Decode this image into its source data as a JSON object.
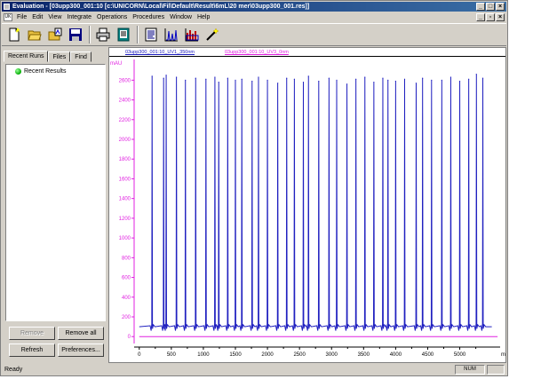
{
  "window": {
    "title": "Evaluation - [03upp300_001:10  [c:\\UNICORN\\Local\\Fil\\Default\\Result\\6mL\\20 mer\\03upp300_001.res]]"
  },
  "menu": {
    "items": [
      "File",
      "Edit",
      "View",
      "Integrate",
      "Operations",
      "Procedures",
      "Window",
      "Help"
    ]
  },
  "toolbar": {
    "buttons": [
      "new-icon",
      "open-folder-icon",
      "open-result-icon",
      "save-icon",
      "print-icon",
      "method-icon",
      "report-icon",
      "chromatogram-icon",
      "peak-table-icon",
      "wand-icon"
    ]
  },
  "left_panel": {
    "tabs": [
      "Recent Runs",
      "Files",
      "Find"
    ],
    "active_tab": "Recent Runs",
    "tree_item": "Recent Results",
    "buttons": {
      "remove": "Remove",
      "remove_all": "Remove all",
      "refresh": "Refresh",
      "preferences": "Preferences..."
    }
  },
  "chart_data": {
    "type": "line",
    "legend": [
      {
        "name": "03upp300_001:10_UV1_350nm",
        "color": "#2020c0"
      },
      {
        "name": "03upp300_001:10_UV3_0nm",
        "color": "#e020e0"
      }
    ],
    "ylabel": "mAU",
    "xlabel": "ml",
    "xlim": [
      -80,
      5630
    ],
    "ylim": [
      -70,
      2720
    ],
    "xticks": [
      0,
      500,
      1000,
      1500,
      2000,
      2500,
      3000,
      3500,
      4000,
      4500,
      5000
    ],
    "yticks": [
      0,
      200,
      400,
      600,
      800,
      1000,
      1200,
      1400,
      1600,
      1800,
      2000,
      2200,
      2400,
      2600
    ],
    "baseline_uv1": 100,
    "baseline_uv3": 0,
    "peaks_x": [
      200,
      380,
      420,
      580,
      720,
      880,
      1040,
      1180,
      1240,
      1380,
      1500,
      1600,
      1760,
      1860,
      2000,
      2160,
      2300,
      2420,
      2560,
      2640,
      2800,
      2960,
      3080,
      3240,
      3380,
      3520,
      3660,
      3800,
      3880,
      4000,
      4140,
      4320,
      4420,
      4560,
      4720,
      4860,
      5000,
      5140,
      5260,
      5360
    ],
    "peaks_y": [
      2640,
      2620,
      2650,
      2630,
      2600,
      2620,
      2610,
      2630,
      2580,
      2620,
      2600,
      2610,
      2590,
      2630,
      2600,
      2570,
      2620,
      2610,
      2580,
      2640,
      2590,
      2620,
      2600,
      2560,
      2610,
      2630,
      2580,
      2620,
      2600,
      2590,
      2610,
      2570,
      2620,
      2600,
      2600,
      2630,
      2590,
      2610,
      2660,
      2620
    ]
  },
  "status": {
    "text": "Ready",
    "num": "NUM"
  }
}
